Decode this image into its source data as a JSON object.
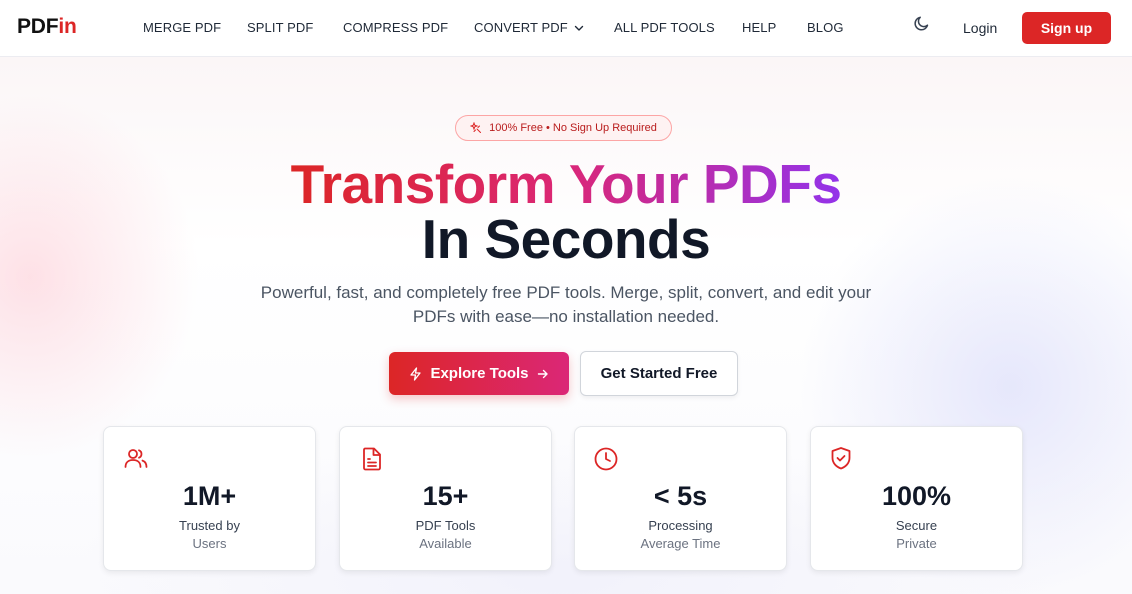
{
  "brand": {
    "logo_part1": "PDF",
    "logo_part2": "in"
  },
  "nav": {
    "items": [
      {
        "label": "MERGE PDF"
      },
      {
        "label": "SPLIT PDF"
      },
      {
        "label": "COMPRESS PDF"
      },
      {
        "label": "CONVERT PDF",
        "has_dropdown": true
      },
      {
        "label": "ALL PDF TOOLS"
      },
      {
        "label": "HELP"
      },
      {
        "label": "BLOG"
      }
    ],
    "theme_toggle_icon": "moon-icon",
    "login_label": "Login",
    "signup_label": "Sign up"
  },
  "hero": {
    "badge": "100% Free • No Sign Up Required",
    "badge_icon": "sparkle-icon",
    "headline_part1": "Transform Your PDFs",
    "headline_part2": "In Seconds",
    "subtitle": "Powerful, fast, and completely free PDF tools. Merge, split, convert, and edit your PDFs with ease—no installation needed.",
    "explore_button": "Explore Tools",
    "explore_icon_left": "lightning-icon",
    "explore_icon_right": "arrow-right-icon",
    "started_button": "Get Started Free"
  },
  "stats": [
    {
      "icon": "users-icon",
      "value": "1M+",
      "label": "Trusted by",
      "sublabel": "Users"
    },
    {
      "icon": "document-icon",
      "value": "15+",
      "label": "PDF Tools",
      "sublabel": "Available"
    },
    {
      "icon": "clock-icon",
      "value": "< 5s",
      "label": "Processing",
      "sublabel": "Average Time"
    },
    {
      "icon": "shield-check-icon",
      "value": "100%",
      "label": "Secure",
      "sublabel": "Private"
    }
  ],
  "colors": {
    "accent": "#dc2626",
    "gradient_mid": "#db2777",
    "gradient_end": "#9333ea",
    "text_dark": "#111827"
  }
}
